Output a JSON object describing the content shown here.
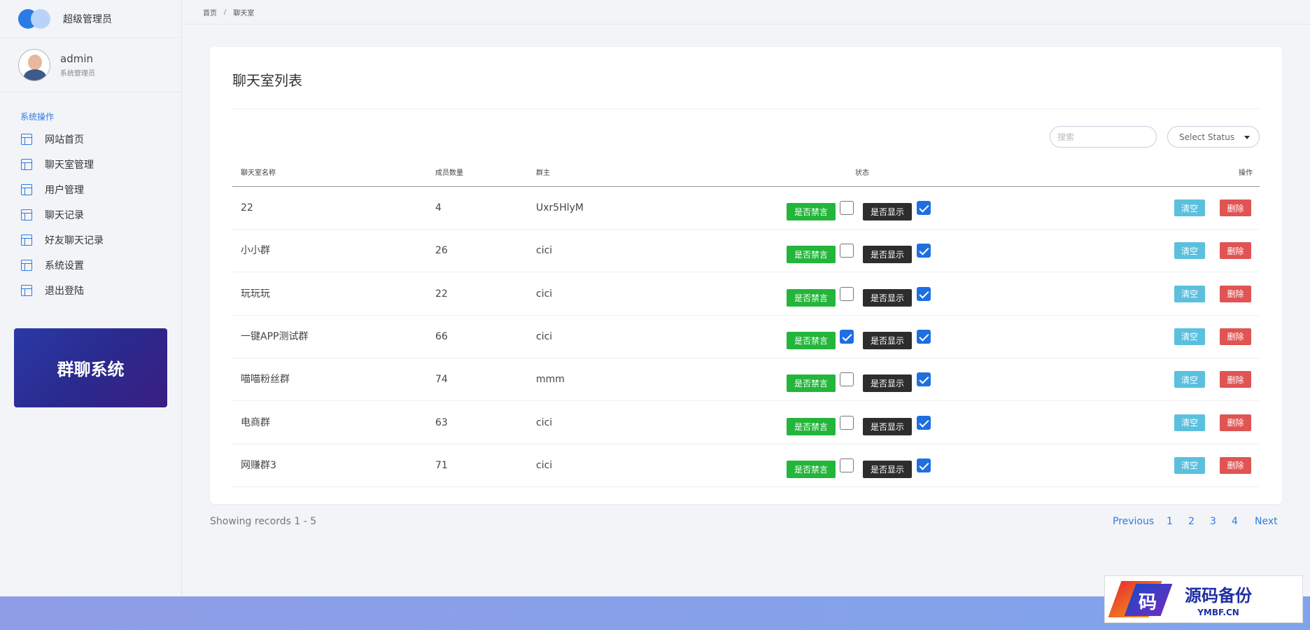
{
  "brand": {
    "title": "超级管理员"
  },
  "user": {
    "name": "admin",
    "role": "系统管理员"
  },
  "sidebar": {
    "section_title": "系统操作",
    "items": [
      {
        "label": "网站首页",
        "icon": "layout-icon"
      },
      {
        "label": "聊天室管理",
        "icon": "layout-icon"
      },
      {
        "label": "用户管理",
        "icon": "layout-icon"
      },
      {
        "label": "聊天记录",
        "icon": "layout-icon"
      },
      {
        "label": "好友聊天记录",
        "icon": "layout-icon"
      },
      {
        "label": "系统设置",
        "icon": "layout-icon"
      },
      {
        "label": "退出登陆",
        "icon": "layout-icon"
      }
    ],
    "promo": "群聊系统"
  },
  "breadcrumb": {
    "home": "首页",
    "sep": "/",
    "current": "聊天室"
  },
  "card": {
    "title": "聊天室列表",
    "search_placeholder": "搜索",
    "status_select": "Select Status"
  },
  "table": {
    "headers": {
      "name": "聊天室名称",
      "members": "成员数量",
      "owner": "群主",
      "status": "状态",
      "actions": "操作"
    },
    "mute_label": "是否禁言",
    "show_label": "是否显示",
    "clear_label": "清空",
    "delete_label": "删除",
    "rows": [
      {
        "name": "22",
        "members": "4",
        "owner": "Uxr5HlyM",
        "muted": false,
        "shown": true
      },
      {
        "name": "小小群",
        "members": "26",
        "owner": "cici",
        "muted": false,
        "shown": true
      },
      {
        "name": "玩玩玩",
        "members": "22",
        "owner": "cici",
        "muted": false,
        "shown": true
      },
      {
        "name": "一键APP测试群",
        "members": "66",
        "owner": "cici",
        "muted": true,
        "shown": true
      },
      {
        "name": "喵喵粉丝群",
        "members": "74",
        "owner": "mmm",
        "muted": false,
        "shown": true
      },
      {
        "name": "电商群",
        "members": "63",
        "owner": "cici",
        "muted": false,
        "shown": true
      },
      {
        "name": "网赚群3",
        "members": "71",
        "owner": "cici",
        "muted": false,
        "shown": true
      }
    ]
  },
  "pagination": {
    "records": "Showing records 1 - 5",
    "previous": "Previous",
    "pages": [
      "1",
      "2",
      "3",
      "4"
    ],
    "next": "Next"
  },
  "watermark": {
    "glyph": "码",
    "big": "源码备份",
    "small": "YMBF.CN"
  },
  "colors": {
    "accent": "#2b7be4",
    "green": "#24b53b",
    "dark": "#2d2d2d",
    "clear": "#5bc0de",
    "delete": "#e05454",
    "checked": "#1e6fe0"
  }
}
